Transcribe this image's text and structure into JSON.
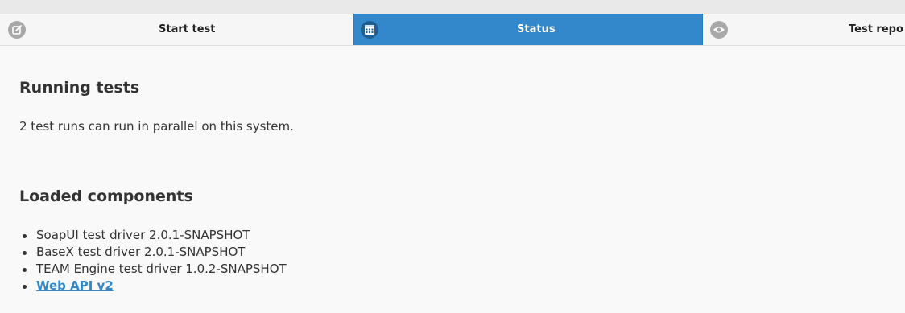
{
  "nav": {
    "tabs": [
      {
        "label": "Start test",
        "icon": "edit-icon",
        "active": false
      },
      {
        "label": "Status",
        "icon": "calendar-icon",
        "active": true
      },
      {
        "label": "Test repo",
        "icon": "eye-icon",
        "active": false
      }
    ]
  },
  "running": {
    "heading": "Running tests",
    "text": "2 test runs can run in parallel on this system."
  },
  "components": {
    "heading": "Loaded components",
    "items": [
      "SoapUI test driver 2.0.1-SNAPSHOT",
      "BaseX test driver 2.0.1-SNAPSHOT",
      "TEAM Engine test driver 1.0.2-SNAPSHOT"
    ],
    "link": "Web API v2"
  },
  "colors": {
    "accent": "#3388cc",
    "background": "#f9f9f9",
    "text": "#333333"
  }
}
